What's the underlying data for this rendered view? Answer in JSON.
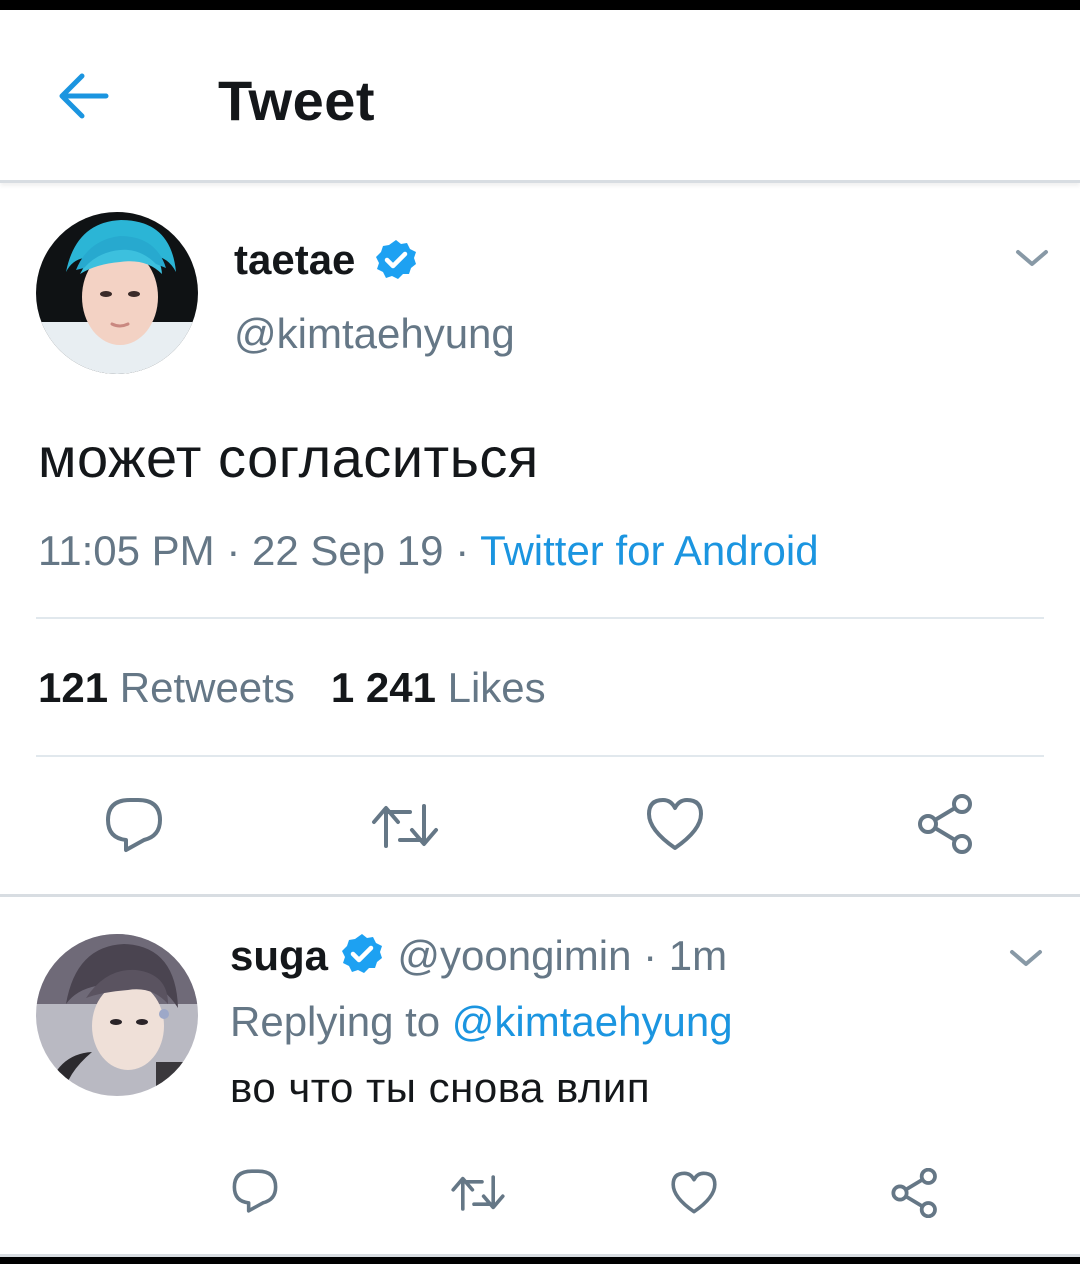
{
  "header": {
    "title": "Tweet",
    "back_icon": "arrow-left-icon"
  },
  "colors": {
    "accent": "#1b95e0",
    "text": "#14171a",
    "muted": "#657786",
    "divider": "#e1e8ed",
    "verified": "#1da1f2"
  },
  "tweet": {
    "display_name": "taetae",
    "handle": "@kimtaehyung",
    "verified": true,
    "text": "может согласиться",
    "time": "11:05 PM",
    "date": "22 Sep 19",
    "separator": "·",
    "source": "Twitter for Android",
    "retweets_count": "121",
    "retweets_label": "Retweets",
    "likes_count": "1 241",
    "likes_label": "Likes",
    "actions": [
      "reply-icon",
      "retweet-icon",
      "like-icon",
      "share-icon"
    ]
  },
  "reply": {
    "display_name": "suga",
    "handle": "@yoongimin",
    "separator": "·",
    "time_ago": "1m",
    "verified": true,
    "replying_to_label": "Replying to",
    "replying_to_handle": "@kimtaehyung",
    "text": "во что ты снова влип",
    "actions": [
      "reply-icon",
      "retweet-icon",
      "like-icon",
      "share-icon"
    ]
  }
}
